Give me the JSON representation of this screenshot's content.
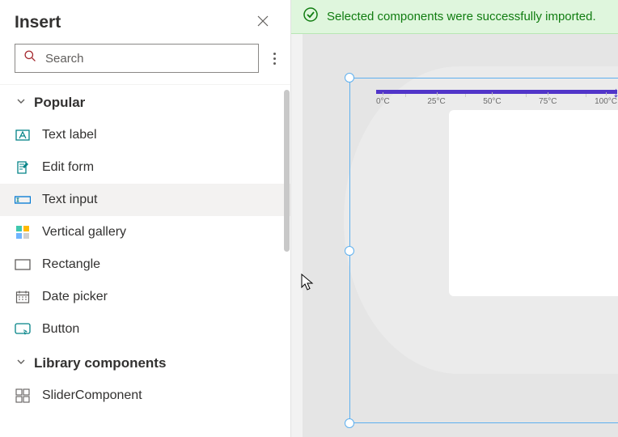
{
  "panel": {
    "title": "Insert",
    "search": {
      "placeholder": "Search",
      "value": ""
    }
  },
  "sections": [
    {
      "id": "popular",
      "label": "Popular",
      "expanded": true,
      "items": [
        {
          "id": "text-label",
          "label": "Text label",
          "icon": "text-label-icon"
        },
        {
          "id": "edit-form",
          "label": "Edit form",
          "icon": "edit-form-icon"
        },
        {
          "id": "text-input",
          "label": "Text input",
          "icon": "text-input-icon",
          "hover": true
        },
        {
          "id": "vertical-gallery",
          "label": "Vertical gallery",
          "icon": "vertical-gallery-icon"
        },
        {
          "id": "rectangle",
          "label": "Rectangle",
          "icon": "rectangle-icon"
        },
        {
          "id": "date-picker",
          "label": "Date picker",
          "icon": "date-picker-icon"
        },
        {
          "id": "button",
          "label": "Button",
          "icon": "button-icon"
        }
      ]
    },
    {
      "id": "library",
      "label": "Library components",
      "expanded": true,
      "items": [
        {
          "id": "slider-component",
          "label": "SliderComponent",
          "icon": "component-icon"
        }
      ]
    }
  ],
  "banner": {
    "message": "Selected components were successfully imported.",
    "icon": "success-check-icon"
  },
  "slider_preview": {
    "ticks": [
      "0°C",
      "25°C",
      "50°C",
      "75°C",
      "100°C"
    ]
  },
  "colors": {
    "selection": "#5eb0ef",
    "success": "#107c10",
    "slider": "#5135c9"
  }
}
